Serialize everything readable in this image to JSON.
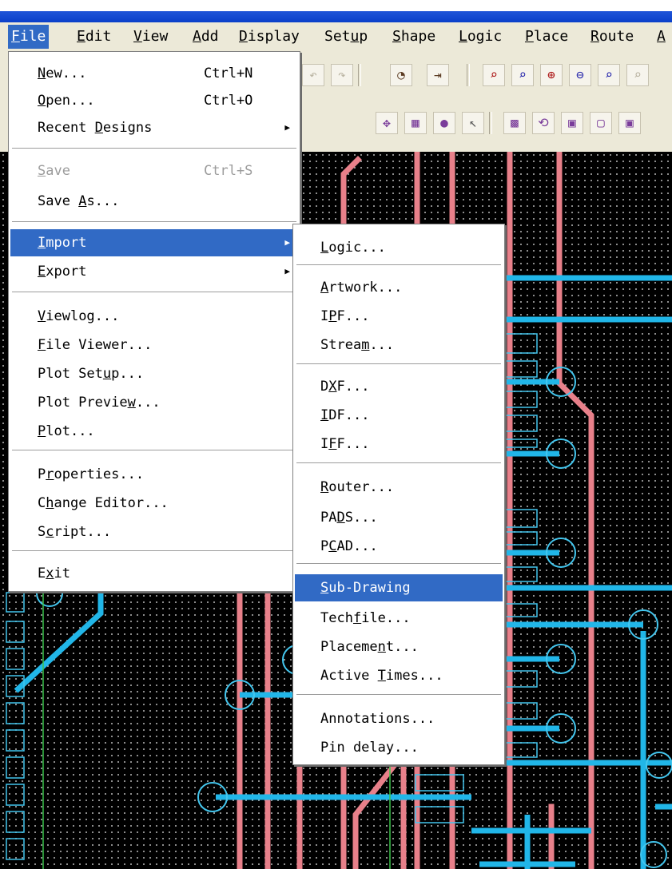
{
  "menubar": {
    "items": [
      {
        "key": "F",
        "rest": "ile"
      },
      {
        "key": "E",
        "rest": "dit"
      },
      {
        "key": "V",
        "rest": "iew"
      },
      {
        "key": "A",
        "rest": "dd"
      },
      {
        "key": "D",
        "rest": "isplay"
      },
      {
        "pre": "Set",
        "key": "u",
        "rest": "p"
      },
      {
        "key": "S",
        "rest": "hape"
      },
      {
        "key": "L",
        "rest": "ogic"
      },
      {
        "key": "P",
        "rest": "lace"
      },
      {
        "key": "R",
        "rest": "oute"
      },
      {
        "key": "A",
        "rest": ""
      }
    ]
  },
  "file_menu": {
    "items": [
      {
        "pre": "",
        "key": "N",
        "rest": "ew...",
        "shortcut": "Ctrl+N"
      },
      {
        "pre": "",
        "key": "O",
        "rest": "pen...",
        "shortcut": "Ctrl+O"
      },
      {
        "pre": "Recent ",
        "key": "D",
        "rest": "esigns",
        "shortcut": ""
      },
      {
        "pre": "",
        "key": "S",
        "rest": "ave",
        "shortcut": "Ctrl+S"
      },
      {
        "pre": "Save ",
        "key": "A",
        "rest": "s...",
        "shortcut": ""
      },
      {
        "pre": "",
        "key": "I",
        "rest": "mport",
        "shortcut": ""
      },
      {
        "pre": "",
        "key": "E",
        "rest": "xport",
        "shortcut": ""
      },
      {
        "pre": "",
        "key": "V",
        "rest": "iewlog...",
        "shortcut": ""
      },
      {
        "pre": "",
        "key": "F",
        "rest": "ile Viewer...",
        "shortcut": ""
      },
      {
        "pre": "Plot Set",
        "key": "u",
        "rest": "p...",
        "shortcut": ""
      },
      {
        "pre": "Plot Previe",
        "key": "w",
        "rest": "...",
        "shortcut": ""
      },
      {
        "pre": "",
        "key": "P",
        "rest": "lot...",
        "shortcut": ""
      },
      {
        "pre": "P",
        "key": "r",
        "rest": "operties...",
        "shortcut": ""
      },
      {
        "pre": "C",
        "key": "h",
        "rest": "ange Editor...",
        "shortcut": ""
      },
      {
        "pre": "S",
        "key": "c",
        "rest": "ript...",
        "shortcut": ""
      },
      {
        "pre": "E",
        "key": "x",
        "rest": "it",
        "shortcut": ""
      }
    ]
  },
  "import_menu": {
    "items": [
      {
        "pre": "",
        "key": "L",
        "rest": "ogic..."
      },
      {
        "pre": "",
        "key": "A",
        "rest": "rtwork..."
      },
      {
        "pre": "I",
        "key": "P",
        "rest": "F..."
      },
      {
        "pre": "Strea",
        "key": "m",
        "rest": "..."
      },
      {
        "pre": "D",
        "key": "X",
        "rest": "F..."
      },
      {
        "pre": "",
        "key": "I",
        "rest": "DF..."
      },
      {
        "pre": "I",
        "key": "F",
        "rest": "F..."
      },
      {
        "pre": "",
        "key": "R",
        "rest": "outer..."
      },
      {
        "pre": "PA",
        "key": "D",
        "rest": "S..."
      },
      {
        "pre": "P",
        "key": "C",
        "rest": "AD..."
      },
      {
        "pre": "",
        "key": "S",
        "rest": "ub-Drawing"
      },
      {
        "pre": "Tech",
        "key": "f",
        "rest": "ile..."
      },
      {
        "pre": "Placeme",
        "key": "n",
        "rest": "t..."
      },
      {
        "pre": "Active ",
        "key": "T",
        "rest": "imes..."
      },
      {
        "pre": "",
        "key": "",
        "rest": "Annotations..."
      },
      {
        "pre": "",
        "key": "",
        "rest": "Pin delay..."
      }
    ]
  },
  "colors": {
    "menu_highlight": "#316ac5",
    "trace_pink": "#e8808a",
    "trace_cyan": "#21b6e8",
    "pad_cyan": "#43c6ee",
    "canvas_bg": "#000000"
  },
  "toolbar_icons": [
    "undo-icon",
    "redo-icon",
    "shape-icon",
    "pin-icon",
    "zoom-pick-icon",
    "zoom-fit-icon",
    "zoom-in-icon",
    "zoom-out-icon",
    "zoom-world-icon",
    "shape-fill-icon",
    "grid-icon",
    "circle-icon",
    "select-arrow-icon",
    "pattern-icon",
    "rotate-icon",
    "square-icon",
    "square-outline-icon"
  ]
}
